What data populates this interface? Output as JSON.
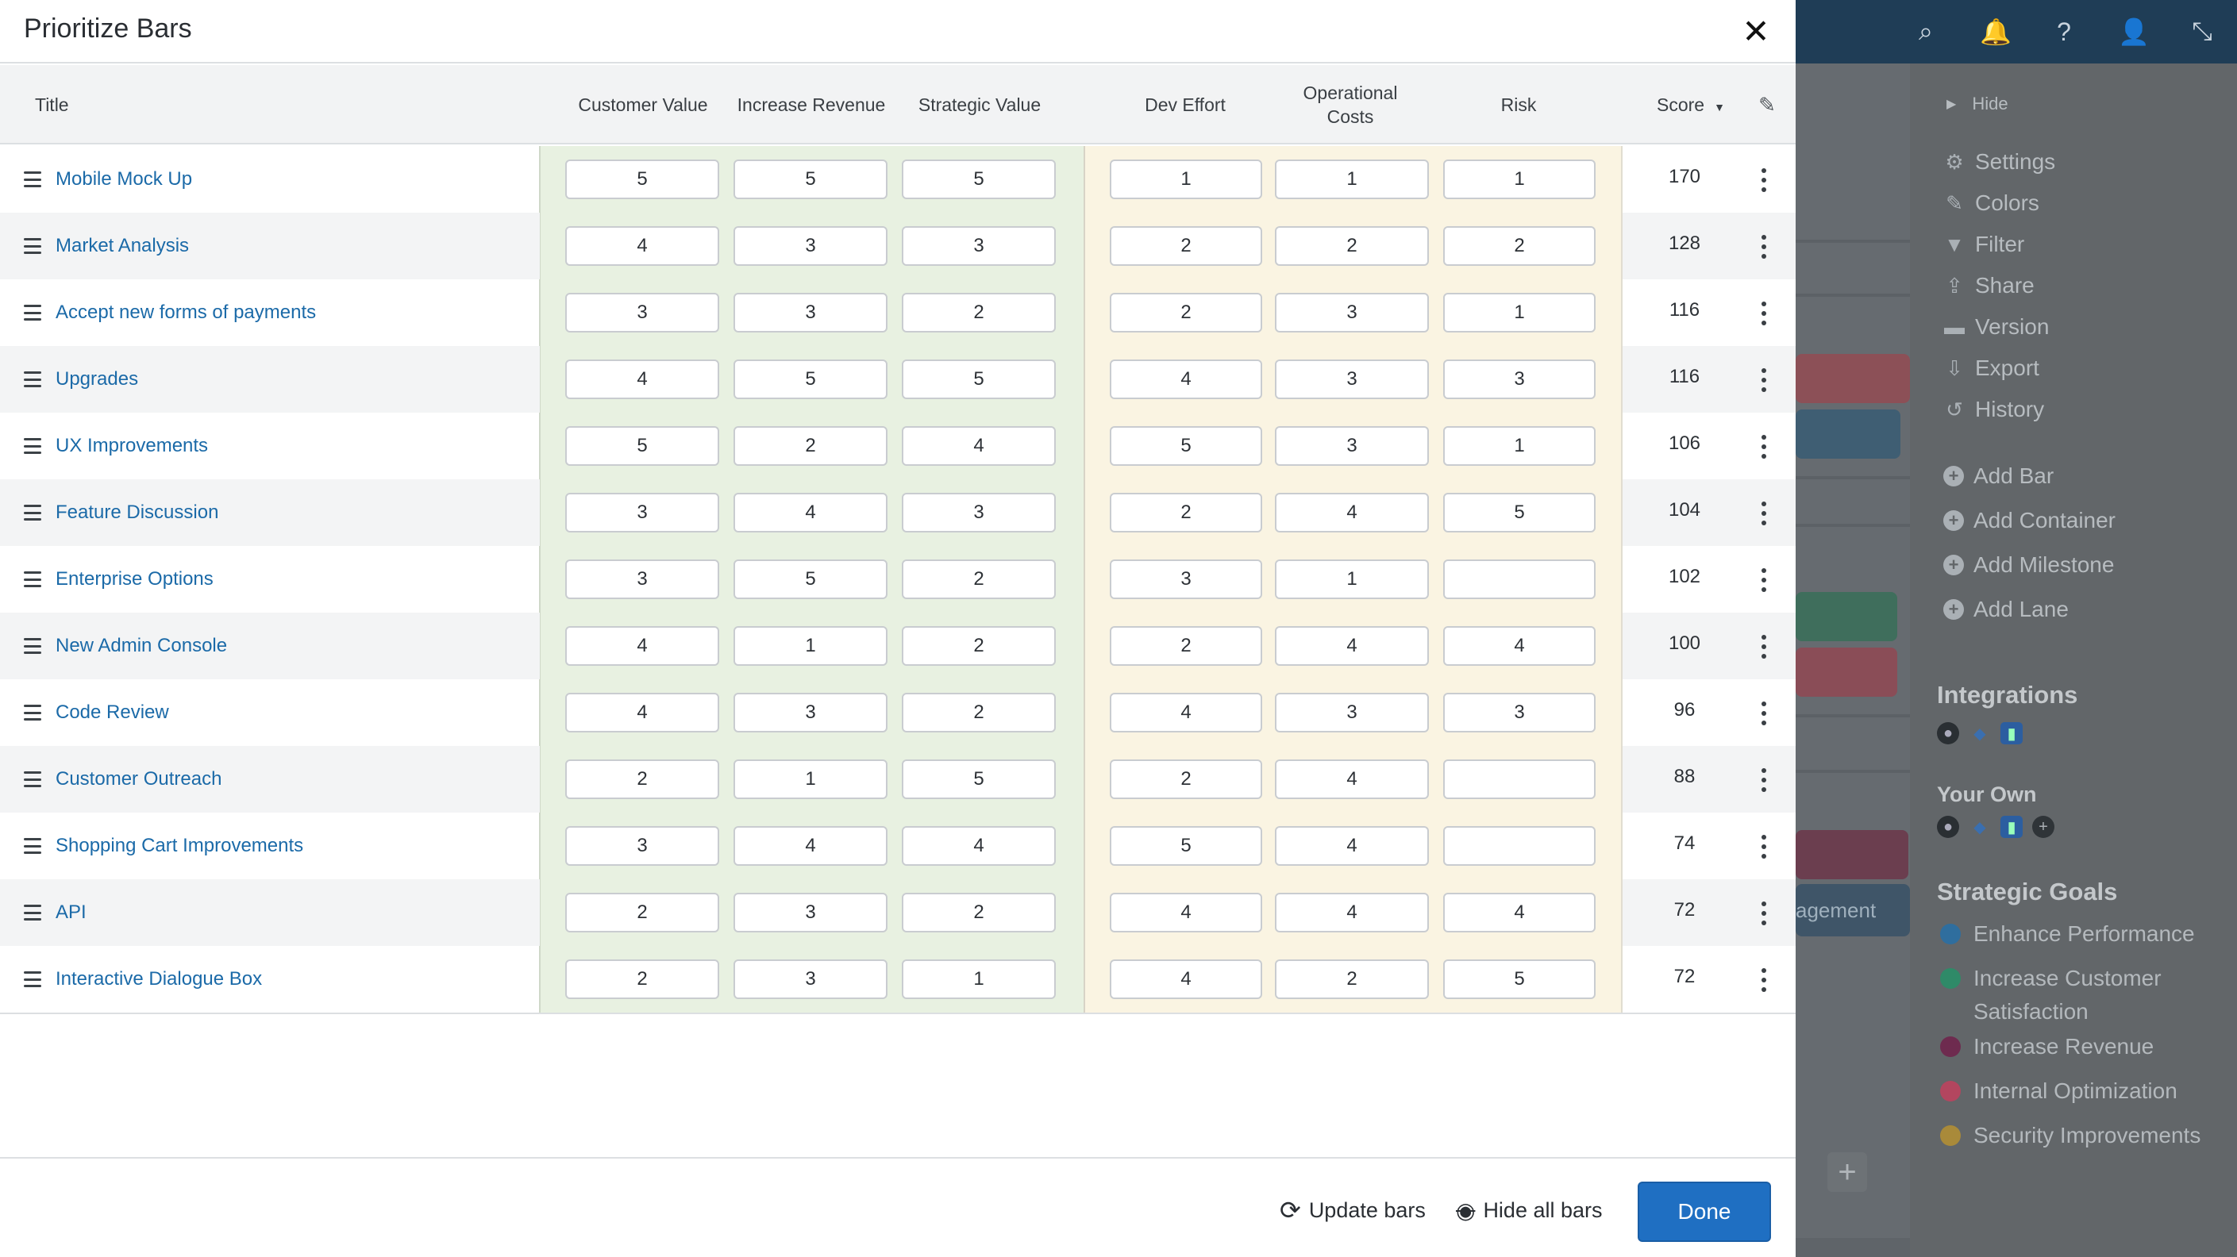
{
  "modal": {
    "title": "Prioritize Bars",
    "close_icon": "close-icon"
  },
  "columns": {
    "title": "Title",
    "customer_value": "Customer Value",
    "increase_revenue": "Increase Revenue",
    "strategic_value": "Strategic Value",
    "dev_effort": "Dev Effort",
    "operational_costs_line1": "Operational",
    "operational_costs_line2": "Costs",
    "risk": "Risk",
    "score": "Score",
    "sort_icon": "caret-down-icon",
    "edit_icon": "pencil-icon"
  },
  "rows": [
    {
      "title": "Mobile Mock Up",
      "cv": "5",
      "ir": "5",
      "sv": "5",
      "de": "1",
      "oc": "1",
      "risk": "1",
      "score": "170"
    },
    {
      "title": "Market Analysis",
      "cv": "4",
      "ir": "3",
      "sv": "3",
      "de": "2",
      "oc": "2",
      "risk": "2",
      "score": "128"
    },
    {
      "title": "Accept new forms of payments",
      "cv": "3",
      "ir": "3",
      "sv": "2",
      "de": "2",
      "oc": "3",
      "risk": "1",
      "score": "116"
    },
    {
      "title": "Upgrades",
      "cv": "4",
      "ir": "5",
      "sv": "5",
      "de": "4",
      "oc": "3",
      "risk": "3",
      "score": "116"
    },
    {
      "title": "UX Improvements",
      "cv": "5",
      "ir": "2",
      "sv": "4",
      "de": "5",
      "oc": "3",
      "risk": "1",
      "score": "106"
    },
    {
      "title": "Feature Discussion",
      "cv": "3",
      "ir": "4",
      "sv": "3",
      "de": "2",
      "oc": "4",
      "risk": "5",
      "score": "104"
    },
    {
      "title": "Enterprise Options",
      "cv": "3",
      "ir": "5",
      "sv": "2",
      "de": "3",
      "oc": "1",
      "risk": "",
      "score": "102"
    },
    {
      "title": "New Admin Console",
      "cv": "4",
      "ir": "1",
      "sv": "2",
      "de": "2",
      "oc": "4",
      "risk": "4",
      "score": "100"
    },
    {
      "title": "Code Review",
      "cv": "4",
      "ir": "3",
      "sv": "2",
      "de": "4",
      "oc": "3",
      "risk": "3",
      "score": "96"
    },
    {
      "title": "Customer Outreach",
      "cv": "2",
      "ir": "1",
      "sv": "5",
      "de": "2",
      "oc": "4",
      "risk": "",
      "score": "88"
    },
    {
      "title": "Shopping Cart Improvements",
      "cv": "3",
      "ir": "4",
      "sv": "4",
      "de": "5",
      "oc": "4",
      "risk": "",
      "score": "74"
    },
    {
      "title": "API",
      "cv": "2",
      "ir": "3",
      "sv": "2",
      "de": "4",
      "oc": "4",
      "risk": "4",
      "score": "72"
    },
    {
      "title": "Interactive Dialogue Box",
      "cv": "2",
      "ir": "3",
      "sv": "1",
      "de": "4",
      "oc": "2",
      "risk": "5",
      "score": "72"
    }
  ],
  "footer": {
    "update_label": "Update bars",
    "hide_label": "Hide all bars",
    "done_label": "Done"
  },
  "sidebar": {
    "hide_label": "Hide",
    "menu": [
      {
        "label": "Settings",
        "icon": "gear-icon",
        "glyph": "⚙"
      },
      {
        "label": "Colors",
        "icon": "brush-icon",
        "glyph": "✎"
      },
      {
        "label": "Filter",
        "icon": "filter-icon",
        "glyph": "▼"
      },
      {
        "label": "Share",
        "icon": "share-icon",
        "glyph": "⇪"
      },
      {
        "label": "Version",
        "icon": "archive-icon",
        "glyph": "▬"
      },
      {
        "label": "Export",
        "icon": "download-icon",
        "glyph": "⇩"
      },
      {
        "label": "History",
        "icon": "history-icon",
        "glyph": "↺"
      }
    ],
    "add": [
      {
        "label": "Add Bar",
        "icon": "plus-circle-icon"
      },
      {
        "label": "Add Container",
        "icon": "plus-circle-icon"
      },
      {
        "label": "Add Milestone",
        "icon": "plus-circle-icon"
      },
      {
        "label": "Add Lane",
        "icon": "plus-circle-icon"
      }
    ],
    "integrations_heading": "Integrations",
    "your_own_heading": "Your Own",
    "goals_heading": "Strategic Goals",
    "goals": [
      {
        "label": "Enhance Performance",
        "color": "#2f6e9e"
      },
      {
        "label": "Increase Customer Satisfaction",
        "color": "#2f8a68"
      },
      {
        "label": "Increase Revenue",
        "color": "#6e2b4f"
      },
      {
        "label": "Internal Optimization",
        "color": "#b3465f"
      },
      {
        "label": "Security Improvements",
        "color": "#a98a3a"
      }
    ]
  },
  "topbar_icons": [
    "search-icon",
    "bell-icon",
    "help-icon",
    "user-icon",
    "fullscreen-icon"
  ],
  "background_text": {
    "bar_partial": "agement"
  }
}
